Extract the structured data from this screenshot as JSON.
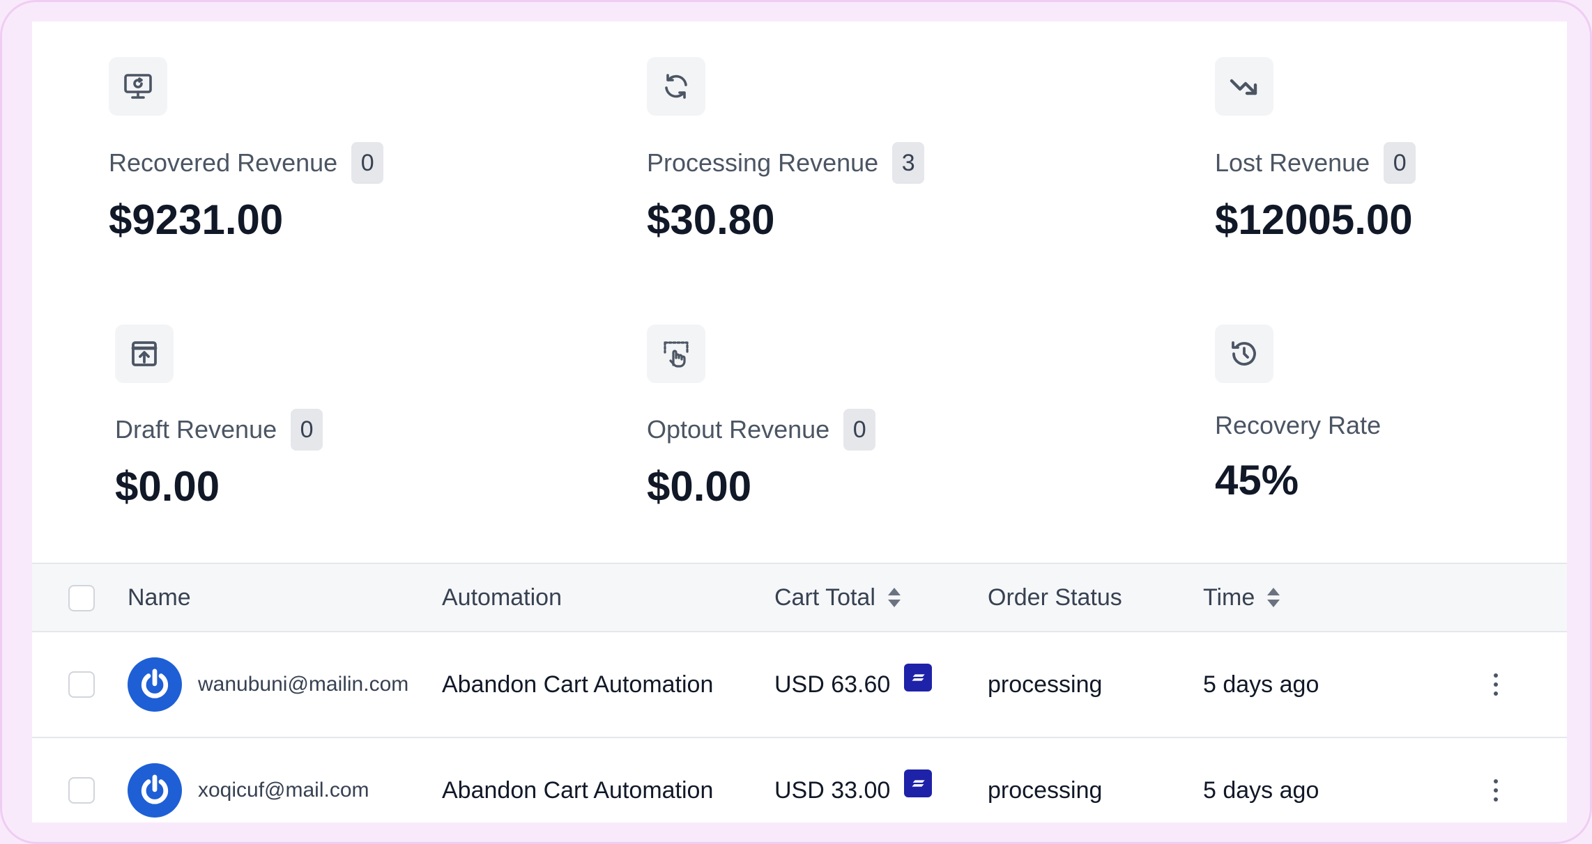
{
  "stats": [
    {
      "label": "Recovered Revenue",
      "badge": "0",
      "value": "$9231.00",
      "icon": "recover-monitor-icon"
    },
    {
      "label": "Processing Revenue",
      "badge": "3",
      "value": "$30.80",
      "icon": "refresh-icon"
    },
    {
      "label": "Lost Revenue",
      "badge": "0",
      "value": "$12005.00",
      "icon": "trending-down-icon"
    },
    {
      "label": "Draft Revenue",
      "badge": "0",
      "value": "$0.00",
      "icon": "upload-window-icon"
    },
    {
      "label": "Optout Revenue",
      "badge": "0",
      "value": "$0.00",
      "icon": "hand-pointer-select-icon"
    },
    {
      "label": "Recovery Rate",
      "value": "45%",
      "icon": "history-icon"
    }
  ],
  "table": {
    "columns": {
      "name": "Name",
      "automation": "Automation",
      "cart_total": "Cart Total",
      "order_status": "Order Status",
      "time": "Time"
    },
    "rows": [
      {
        "email": "wanubuni@mailin.com",
        "automation": "Abandon Cart Automation",
        "cart_total": "USD 63.60",
        "order_status": "processing",
        "time": "5 days ago"
      },
      {
        "email": "xoqicuf@mail.com",
        "automation": "Abandon Cart Automation",
        "cart_total": "USD 33.00",
        "order_status": "processing",
        "time": "5 days ago"
      }
    ]
  },
  "colors": {
    "frame_bg": "#f9eafb",
    "avatar": "#1e5fd6",
    "payment_icon": "#1e22a8"
  }
}
